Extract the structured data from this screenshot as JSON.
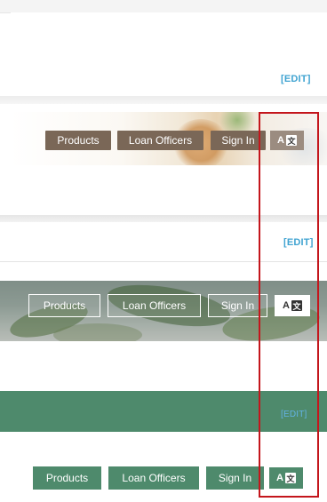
{
  "section1": {
    "edit_label": "[EDIT]",
    "nav": {
      "products": "Products",
      "loan_officers": "Loan Officers",
      "sign_in": "Sign In",
      "lang_letter": "A",
      "lang_glyph": "文"
    }
  },
  "section2": {
    "edit_label": "[EDIT]",
    "nav": {
      "products": "Products",
      "loan_officers": "Loan Officers",
      "sign_in": "Sign In",
      "lang_letter": "A",
      "lang_glyph": "文"
    }
  },
  "section3": {
    "edit_label": "[EDIT]",
    "nav": {
      "products": "Products",
      "loan_officers": "Loan Officers",
      "sign_in": "Sign In",
      "lang_letter": "A",
      "lang_glyph": "文"
    }
  },
  "colors": {
    "brown_button": "#7a6757",
    "green_theme": "#4e8a6c",
    "edit_link": "#3fa3d1",
    "highlight": "#c4161c"
  },
  "icons": {
    "translate": "translate-icon"
  }
}
